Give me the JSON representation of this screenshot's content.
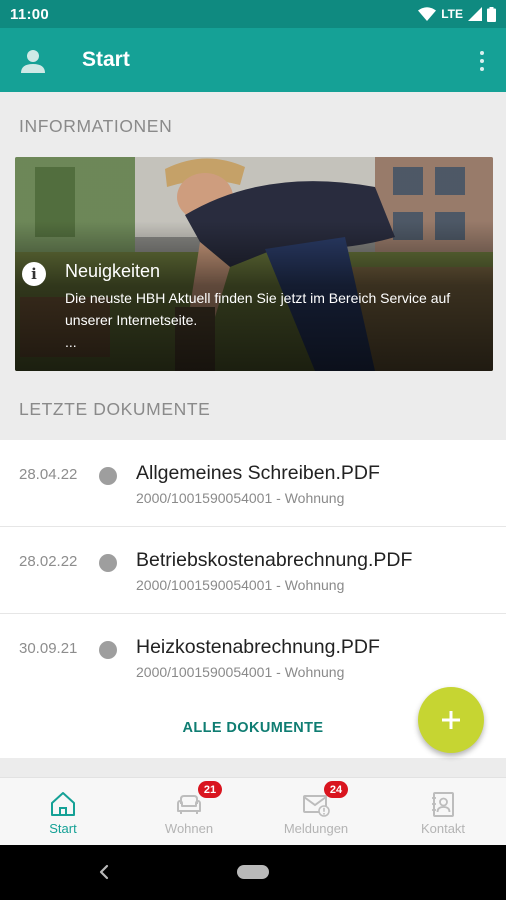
{
  "status_bar": {
    "time": "11:00",
    "network": "LTE",
    "icons": [
      "wifi-icon",
      "signal-icon",
      "battery-icon"
    ]
  },
  "app_bar": {
    "title": "Start",
    "icons": [
      "account-icon",
      "more-vert-icon"
    ],
    "color": "#15a196"
  },
  "informationen": {
    "header": "INFORMATIONEN",
    "news": {
      "icon": "info-icon",
      "title": "Neuigkeiten",
      "text": "Die neuste HBH Aktuell finden Sie jetzt im Bereich Service auf unserer Internetseite.",
      "ellipsis": "..."
    }
  },
  "documents": {
    "header": "LETZTE DOKUMENTE",
    "items": [
      {
        "date": "28.04.22",
        "name": "Allgemeines Schreiben.PDF",
        "meta": "2000/1001590054001 - Wohnung"
      },
      {
        "date": "28.02.22",
        "name": "Betriebskostenabrechnung.PDF",
        "meta": "2000/1001590054001 - Wohnung"
      },
      {
        "date": "30.09.21",
        "name": "Heizkostenabrechnung.PDF",
        "meta": "2000/1001590054001 - Wohnung"
      }
    ],
    "all_label": "ALLE DOKUMENTE"
  },
  "fab": {
    "label": "+",
    "color": "#c6d532",
    "icon": "add-icon"
  },
  "bottom_nav": {
    "items": [
      {
        "label": "Start",
        "icon": "home-icon",
        "active": true
      },
      {
        "label": "Wohnen",
        "icon": "sofa-icon",
        "badge": "21"
      },
      {
        "label": "Meldungen",
        "icon": "mail-alert-icon",
        "badge": "24"
      },
      {
        "label": "Kontakt",
        "icon": "contact-book-icon"
      }
    ],
    "active_color": "#15a196",
    "badge_color": "#d9151f"
  }
}
